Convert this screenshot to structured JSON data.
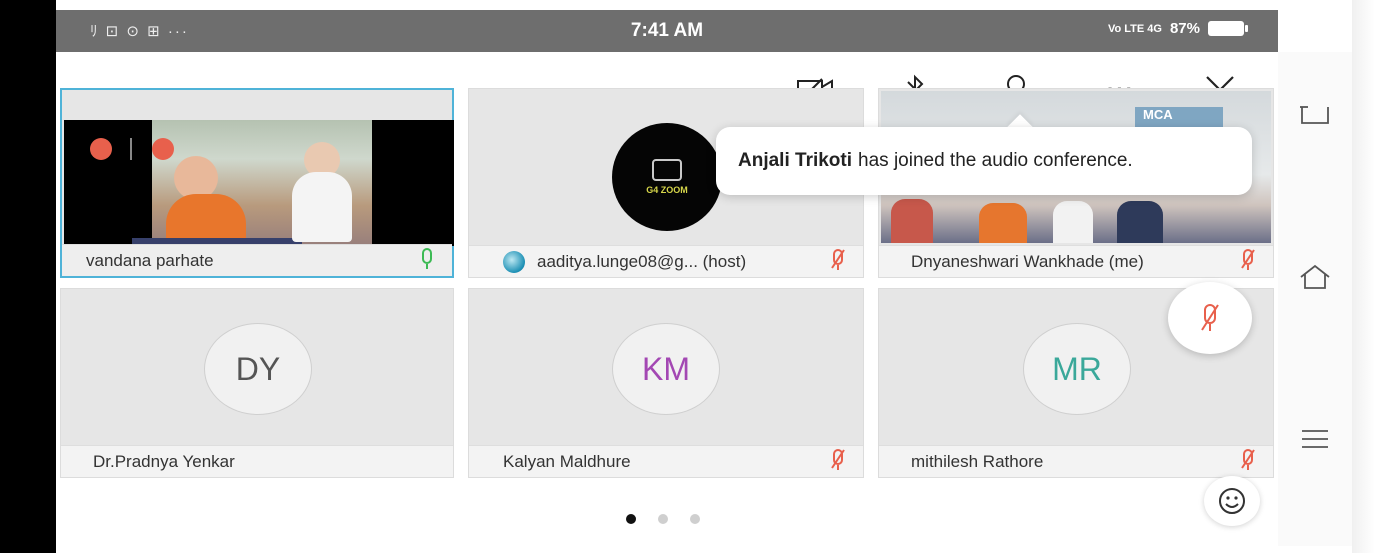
{
  "status_bar": {
    "time": "7:41 AM",
    "left_icons": "ﾘ ⊡ ⊙ ⊞ ···",
    "battery": "87%",
    "network": "Vo LTE 4G"
  },
  "toolbar": {
    "more_label": "···"
  },
  "toast": {
    "name": "Anjali Trikoti",
    "message": "has joined the audio conference."
  },
  "participants": [
    {
      "name": "vandana parhate",
      "mic": "on"
    },
    {
      "name": "aaditya.lunge08@g... (host)",
      "mic": "muted"
    },
    {
      "name": "Dnyaneshwari Wankhade (me)",
      "mic": "muted"
    },
    {
      "name": "Dr.Pradnya Yenkar",
      "initials": "DY",
      "initials_color": "#555555"
    },
    {
      "name": "Kalyan Maldhure",
      "initials": "KM",
      "initials_color": "#a347b3",
      "mic": "muted"
    },
    {
      "name": "mithilesh Rathore",
      "initials": "MR",
      "initials_color": "#3aa89a",
      "mic": "muted"
    }
  ],
  "video_logo_text": "G4 ZOOM",
  "banner_text": "MCA",
  "colors": {
    "muted_mic": "#e8604c",
    "active_mic": "#3cba54",
    "status_bar": "#6e6e6e",
    "tile_bg": "#e6e6e6"
  },
  "pagination": {
    "pages": 3,
    "current": 1
  }
}
